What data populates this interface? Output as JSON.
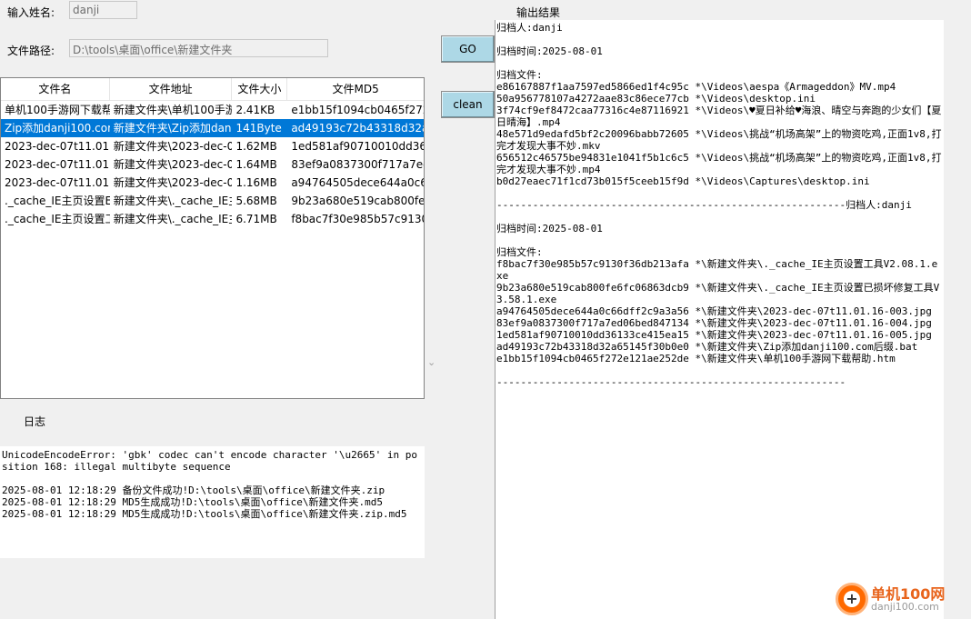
{
  "form": {
    "name_label": "输入姓名:",
    "name_value": "danji",
    "path_label": "文件路径:",
    "path_value": "D:\\tools\\桌面\\office\\新建文件夹",
    "go_label": "GO",
    "clean_label": "clean",
    "log_label": "日志",
    "output_label": "输出结果"
  },
  "table": {
    "columns": [
      "文件名",
      "文件地址",
      "文件大小",
      "文件MD5"
    ],
    "rows": [
      [
        "单机100手游网下载帮",
        "新建文件夹\\单机100手游",
        "2.41KB",
        "e1bb15f1094cb0465f272"
      ],
      [
        "Zip添加danji100.com",
        "新建文件夹\\Zip添加dan",
        "141Byte",
        "ad49193c72b43318d32a6"
      ],
      [
        "2023-dec-07t11.01.",
        "新建文件夹\\2023-dec-0",
        "1.62MB",
        "1ed581af90710010dd361"
      ],
      [
        "2023-dec-07t11.01.",
        "新建文件夹\\2023-dec-0",
        "1.64MB",
        "83ef9a0837300f717a7ed"
      ],
      [
        "2023-dec-07t11.01.",
        "新建文件夹\\2023-dec-0",
        "1.16MB",
        "a94764505dece644a0c66"
      ],
      [
        "._cache_IE主页设置E",
        "新建文件夹\\._cache_IE主",
        "5.68MB",
        "9b23a680e519cab800fe6"
      ],
      [
        "._cache_IE主页设置工",
        "新建文件夹\\._cache_IE主",
        "6.71MB",
        "f8bac7f30e985b57c9130"
      ]
    ],
    "selected_index": 1
  },
  "log": {
    "lines": [
      "UnicodeEncodeError: 'gbk' codec can't encode character '\\u2665' in position 168: illegal multibyte sequence",
      "",
      "2025-08-01 12:18:29 备份文件成功!D:\\tools\\桌面\\office\\新建文件夹.zip",
      "2025-08-01 12:18:29 MD5生成成功!D:\\tools\\桌面\\office\\新建文件夹.md5",
      "2025-08-01 12:18:29 MD5生成成功!D:\\tools\\桌面\\office\\新建文件夹.zip.md5"
    ]
  },
  "output": {
    "lines": [
      "归档人:danji",
      "",
      "归档时间:2025-08-01",
      "",
      "归档文件:",
      "e86167887f1aa7597ed5866ed1f4c95c *\\Videos\\aespa《Armageddon》MV.mp4",
      "50a956778107a4272aae83c86ece77cb *\\Videos\\desktop.ini",
      "3f74cf9ef8472caa77316c4e87116921 *\\Videos\\♥夏日补给♥海浪、晴空与奔跑的少女们【夏日晴海】.mp4",
      "48e571d9edafd5bf2c20096babb72605 *\\Videos\\挑战“机场高架”上的物资吃鸡,正面1v8,打完才发现大事不妙.mkv",
      "656512c46575be94831e1041f5b1c6c5 *\\Videos\\挑战“机场高架”上的物资吃鸡,正面1v8,打完才发现大事不妙.mp4",
      "b0d27eaec71f1cd73b015f5ceeb15f9d *\\Videos\\Captures\\desktop.ini",
      "",
      "----------------------------------------------------------归档人:danji",
      "",
      "归档时间:2025-08-01",
      "",
      "归档文件:",
      "f8bac7f30e985b57c9130f36db213afa *\\新建文件夹\\._cache_IE主页设置工具V2.08.1.exe",
      "9b23a680e519cab800fe6fc06863dcb9 *\\新建文件夹\\._cache_IE主页设置已损坏修复工具V3.58.1.exe",
      "a94764505dece644a0c66dff2c9a3a56 *\\新建文件夹\\2023-dec-07t11.01.16-003.jpg",
      "83ef9a0837300f717a7ed06bed847134 *\\新建文件夹\\2023-dec-07t11.01.16-004.jpg",
      "1ed581af90710010dd36133ce415ea15 *\\新建文件夹\\2023-dec-07t11.01.16-005.jpg",
      "ad49193c72b43318d32a65145f30b0e0 *\\新建文件夹\\Zip添加danji100.com后缀.bat",
      "e1bb15f1094cb0465f272e121ae252de *\\新建文件夹\\单机100手游网下载帮助.htm",
      "",
      "----------------------------------------------------------"
    ]
  },
  "watermark": {
    "plus_glyph": "+",
    "brand": "单机100网",
    "url": "danji100.com"
  }
}
